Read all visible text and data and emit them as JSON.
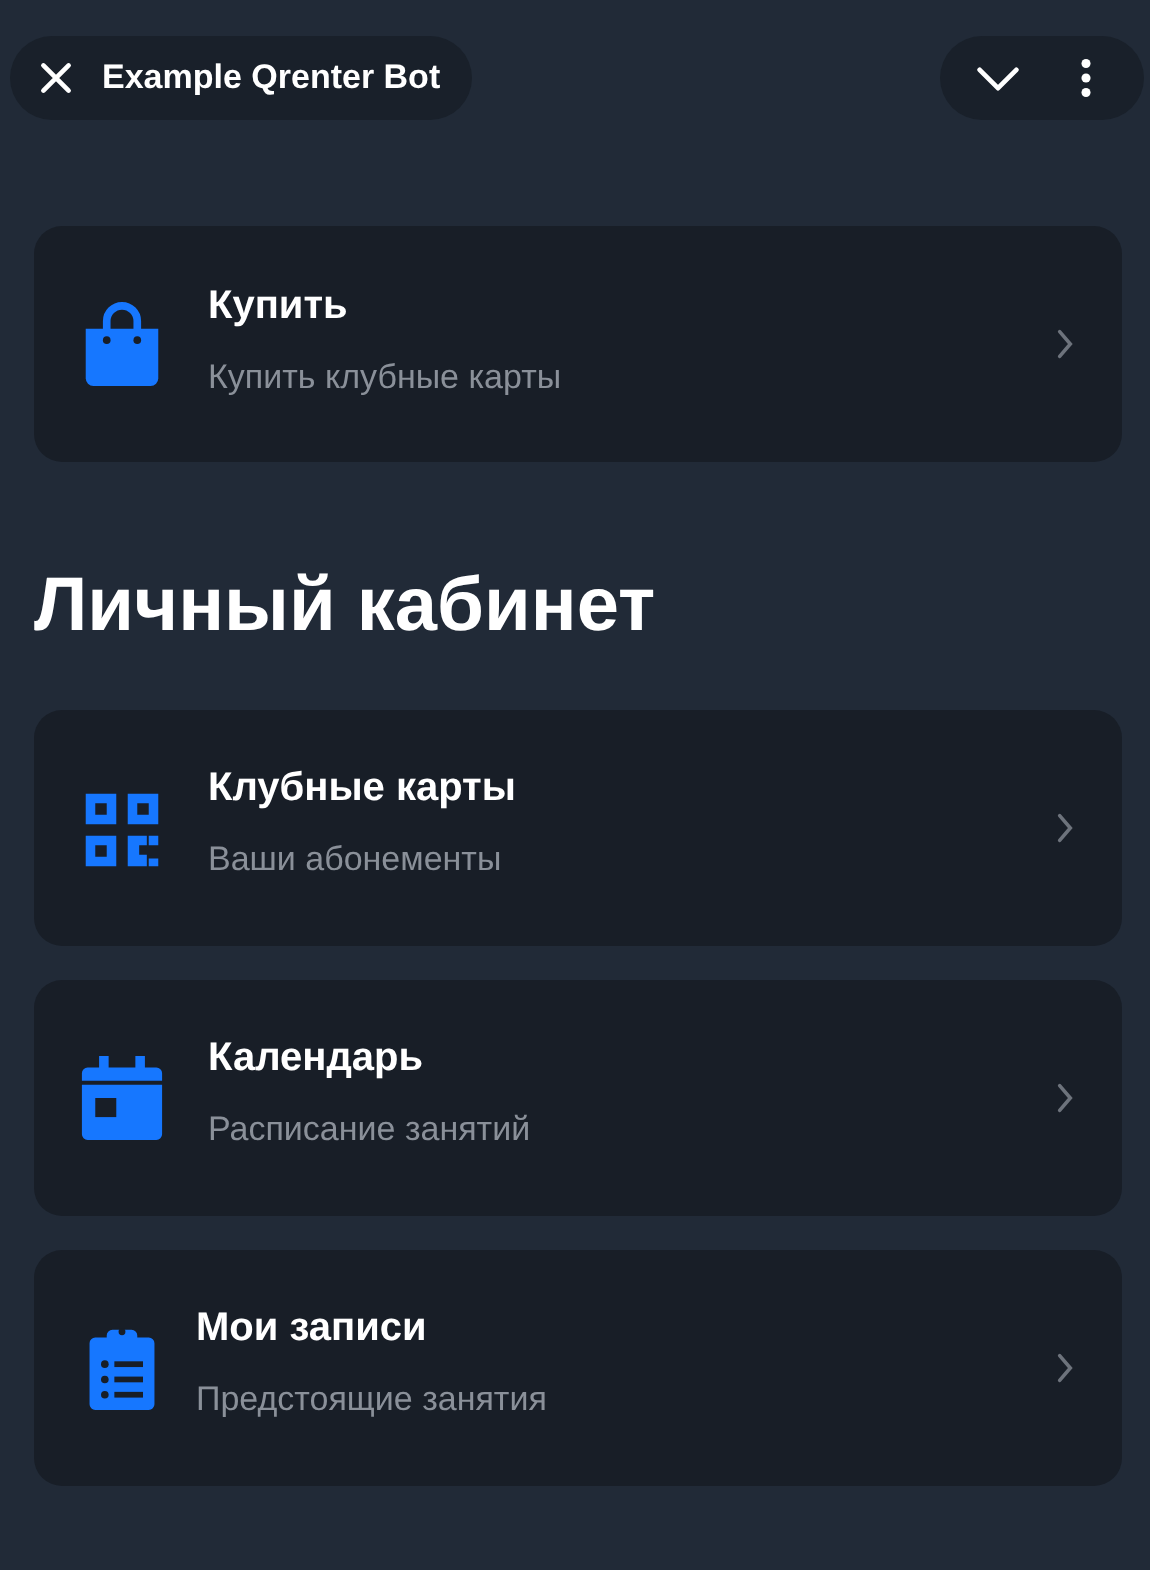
{
  "header": {
    "title": "Example Qrenter Bot"
  },
  "top_items": [
    {
      "kind": "bag",
      "title": "Купить",
      "subtitle": "Купить клубные карты"
    }
  ],
  "section_title": "Личный кабинет",
  "items": [
    {
      "kind": "qr",
      "title": "Клубные карты",
      "subtitle": "Ваши абонементы"
    },
    {
      "kind": "calendar",
      "title": "Календарь",
      "subtitle": "Расписание занятий"
    },
    {
      "kind": "clipboard",
      "title": "Мои записи",
      "subtitle": "Предстоящие занятия"
    }
  ]
}
